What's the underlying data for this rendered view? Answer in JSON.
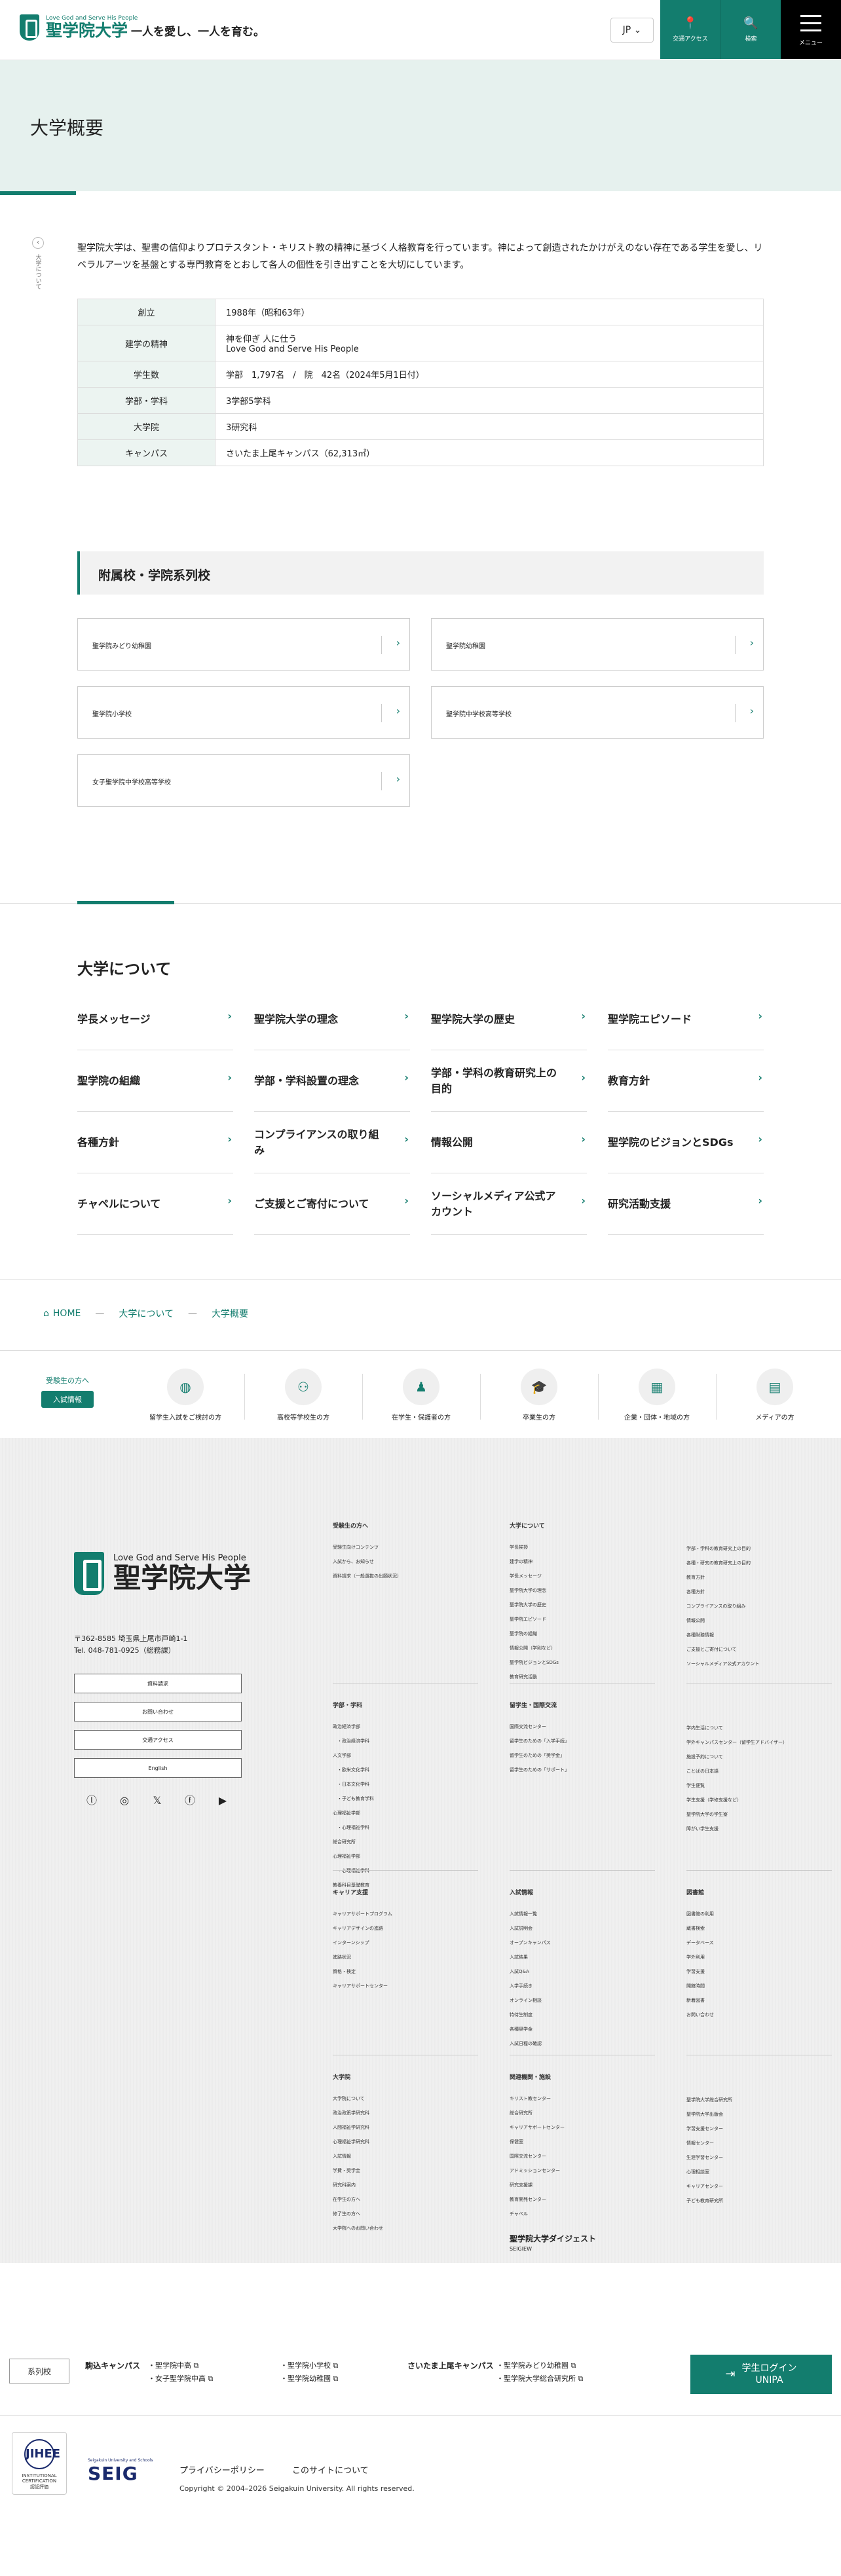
{
  "header": {
    "logo_en": "Love God and Serve His People",
    "logo_ja": "聖学院大学",
    "tagline": "一人を愛し、一人を育む。",
    "lang": "JP",
    "lang_caret": "⌄",
    "access_icon": "📍",
    "access_label": "交通アクセス",
    "search_icon": "🔍",
    "search_label": "検索",
    "menu_label": "メニュー"
  },
  "hero": {
    "title": "大学概要"
  },
  "back": {
    "arrow": "‹",
    "label": "大学について"
  },
  "intro": "聖学院大学は、聖書の信仰よりプロテスタント・キリスト教の精神に基づく人格教育を行っています。神によって創造されたかけがえのない存在である学生を愛し、リベラルアーツを基盤とする専門教育をとおして各人の個性を引き出すことを大切にしています。",
  "overview": [
    {
      "key": "創立",
      "value": "1988年（昭和63年）"
    },
    {
      "key": "建学の精神",
      "value": "神を仰ぎ 人に仕う\nLove God and Serve His People"
    },
    {
      "key": "学生数",
      "value": "学部　1,797名　/　院　42名（2024年5月1日付）"
    },
    {
      "key": "学部・学科",
      "value": "3学部5学科"
    },
    {
      "key": "大学院",
      "value": "3研究科"
    },
    {
      "key": "キャンパス",
      "value": "さいたま上尾キャンパス（62,313㎡）"
    }
  ],
  "schools": {
    "title": "附属校・学院系列校",
    "items": [
      "聖学院みどり幼稚園",
      "聖学院幼稚園",
      "聖学院小学校",
      "聖学院中学校高等学校",
      "女子聖学院中学校高等学校"
    ],
    "arrow": "›"
  },
  "about": {
    "title": "大学について",
    "links": [
      "学長メッセージ",
      "聖学院大学の理念",
      "聖学院大学の歴史",
      "聖学院エピソード",
      "聖学院の組織",
      "学部・学科設置の理念",
      "学部・学科の教育研究上の目的",
      "教育方針",
      "各種方針",
      "コンプライアンスの取り組み",
      "情報公開",
      "聖学院のビジョンとSDGs",
      "チャペルについて",
      "ご支援とご寄付について",
      "ソーシャルメディア公式アカウント",
      "研究活動支援"
    ],
    "arrow": "›"
  },
  "breadcrumb": {
    "home_icon": "⌂",
    "items": [
      "HOME",
      "大学について",
      "大学概要"
    ],
    "sep": "—"
  },
  "targets": {
    "lead_small": "受験生の方へ",
    "lead_button": "入試情報",
    "items": [
      {
        "icon": "◍",
        "label": "留学生入試をご検討の方"
      },
      {
        "icon": "⚇",
        "label": "高校等学校生の方"
      },
      {
        "icon": "♟",
        "label": "在学生・保護者の方"
      },
      {
        "icon": "🎓",
        "label": "卒業生の方"
      },
      {
        "icon": "▦",
        "label": "企業・団体・地域の方"
      },
      {
        "icon": "▤",
        "label": "メディアの方"
      }
    ]
  },
  "footer": {
    "logo_en": "Love God and Serve His People",
    "logo_ja": "聖学院大学",
    "address": "〒362-8585 埼玉県上尾市戸崎1-1",
    "tel": "Tel. 048-781-0925（総務課）",
    "buttons": [
      "資料請求",
      "お問い合わせ",
      "交通アクセス",
      "English"
    ],
    "social": [
      "ⓛ",
      "◎",
      "𝕏",
      "ⓕ",
      "▶"
    ],
    "digest": "聖学院大学ダイジェスト",
    "digest_sub": "SEIGIEW"
  },
  "footer_cols": [
    {
      "title": "受験生の方へ",
      "links": [
        "受験生向けコンテンツ",
        "入試から、お知らせ",
        "資料請求（一般選抜の出願状況）"
      ]
    },
    {
      "title": "大学について",
      "links": [
        "学長挨拶",
        "建学の精神",
        "学長メッセージ",
        "聖学院大学の理念",
        "聖学院大学の歴史",
        "聖学院エピソード",
        "聖学院の組織",
        "情報公開（学則など）",
        "聖学院ビジョンとSDGs",
        "教育研究活動"
      ]
    },
    {
      "title": "",
      "links": [
        "学部・学科の教育研究上の目的",
        "各種・研究の教育研究上の目的",
        "教育方針",
        "各種方針",
        "コンプライアンスの取り組み",
        "情報公開",
        "各種財務情報",
        "ご支援とご寄付について",
        "ソーシャルメディア公式アカウント"
      ]
    },
    {
      "title": "学部・学科",
      "links": [
        "政治経済学部",
        "　・政治経済学科",
        "人文学部",
        "　・欧米文化学科",
        "　・日本文化学科",
        "　・子ども教育学科",
        "心理福祉学部",
        "　・心理福祉学科",
        "総合研究所",
        "心理福祉学部",
        "　・心理福祉学科",
        "教養科目基礎教育"
      ]
    },
    {
      "title": "留学生・国際交流",
      "links": [
        "国際交流センター",
        "留学生のための「入学手続」",
        "留学生のための「奨学金」",
        "留学生のための「サポート」"
      ]
    },
    {
      "title": "",
      "links": [
        "学内生活について",
        "学外キャンパスセンター（留学生アドバイザー）",
        "施設予約について",
        "ことばの日本語",
        "学生便覧",
        "学生支援（学修支援など）",
        "聖学院大学の学生寮",
        "障がい学生支援"
      ]
    },
    {
      "title": "キャリア支援",
      "links": [
        "キャリアサポートプログラム",
        "キャリアデザインの進路",
        "インターンシップ",
        "進路状況",
        "資格・検定",
        "キャリアサポートセンター"
      ]
    },
    {
      "title": "入試情報",
      "links": [
        "入試情報一覧",
        "入試説明会",
        "オープンキャンパス",
        "入試結果",
        "入試Q&A",
        "入学手続き",
        "オンライン相談",
        "特待生制度",
        "各種奨学金",
        "入試日程の確認"
      ]
    },
    {
      "title": "図書館",
      "links": [
        "図書館の利用",
        "蔵書検索",
        "データベース",
        "学外利用",
        "学習支援",
        "開館時間",
        "新着図書",
        "お問い合わせ"
      ]
    },
    {
      "title": "大学院",
      "links": [
        "大学院について",
        "政治政策学研究科",
        "人間福祉学研究科",
        "心理福祉学研究科",
        "入試情報",
        "学費・奨学金",
        "研究科案内",
        "在学生の方へ",
        "修了生の方へ",
        "大学院へのお問い合わせ"
      ]
    },
    {
      "title": "関連機関・施設",
      "links": [
        "キリスト教センター",
        "総合研究所",
        "キャリアサポートセンター",
        "保健室",
        "国際交流センター",
        "アドミッションセンター",
        "研究支援課",
        "教育開発センター",
        "チャペル"
      ]
    },
    {
      "title": "",
      "links": [
        "聖学院大学総合研究所",
        "聖学院大学出版会",
        "学習支援センター",
        "情報センター",
        "生涯学習センター",
        "心理相談室",
        "キャリアセンター",
        "子ども教育研究所"
      ]
    }
  ],
  "bottom": {
    "keiretsu": "系列校",
    "campus1": "駒込キャンパス",
    "campus1_links": [
      "聖学院中高",
      "女子聖学院中高",
      "聖学院小学校",
      "聖学院幼稚園"
    ],
    "campus2": "さいたま上尾キャンパス",
    "campus2_links": [
      "聖学院みどり幼稚園",
      "聖学院大学総合研究所"
    ],
    "ext_icon": "⧉",
    "login_line1": "学生ログイン",
    "login_line2": "UNIPA",
    "login_icon": "⇥",
    "badge_text": "INSTITUTIONAL CERTIFICATION",
    "badge_abbr": "JIHEE",
    "badge_sub": "認証評価",
    "seig_tag": "Seigakuin University and Schools",
    "seig": "SEIG",
    "privacy": "プライバシーポリシー",
    "about_site": "このサイトについて",
    "copyright": "Copyright © 2004–2026 Seigakuin University. All rights reserved."
  },
  "colors": {
    "brand": "#137d6e",
    "hero_bg": "#e6f1ee",
    "footer_bg": "#f0f0f0"
  }
}
